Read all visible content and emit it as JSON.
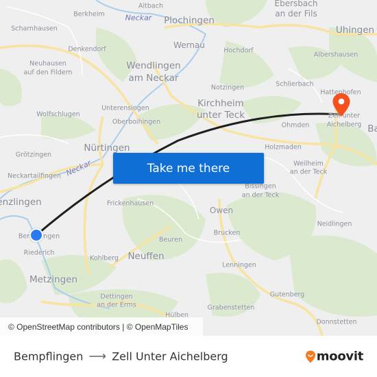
{
  "map": {
    "labels": {
      "altbach": "Altbach",
      "berkheim": "Berkheim",
      "neckar_top": "Neckar",
      "plochingen": "Plochingen",
      "ebersbach1": "Ebersbach",
      "ebersbach2": "an der Fils",
      "uhingen": "Uhingen",
      "scharnhausen": "Scharnhausen",
      "denkendorf": "Denkendorf",
      "wernau": "Wernau",
      "hochdorf": "Hochdorf",
      "albershausen": "Albershausen",
      "neuhausen1": "Neuhausen",
      "neuhausen2": "auf den Fildern",
      "wendlingen1": "Wendlingen",
      "wendlingen2": "am Neckar",
      "notzingen": "Notzingen",
      "schlierbach": "Schlierbach",
      "hattenhofen": "Hattenhofen",
      "unterensingen": "Unterensingen",
      "wolfschlugen": "Wolfschlugen",
      "kirchheim1": "Kirchheim",
      "kirchheim2": "unter Teck",
      "oberboihingen": "Oberboihingen",
      "ohmden": "Ohmden",
      "zell1": "Zell unter",
      "zell2": "Aichelberg",
      "ba": "Ba",
      "nurtingen": "Nürtingen",
      "holzmaden": "Holzmaden",
      "grotzingen": "Grötzingen",
      "weilheim1": "Weilheim",
      "weilheim2": "an der Teck",
      "neckartailfingen": "Neckartailfingen",
      "neckar_mid": "Neckar",
      "bissingen1": "Bissingen",
      "bissingen2": "an der Teck",
      "metzingen_top": "enzlingen",
      "frickenhausen": "Frickenhausen",
      "owen": "Owen",
      "neidlingen": "Neidlingen",
      "bempflingen": "Bempflingen",
      "brucken": "Brucken",
      "beuren": "Beuren",
      "riederich": "Riederich",
      "kohlberg": "Kohlberg",
      "neuffen": "Neuffen",
      "lenningen": "Lenningen",
      "metzingen": "Metzingen",
      "dettingen1": "Dettingen",
      "dettingen2": "an der Erms",
      "gutenberg": "Gutenberg",
      "grabenstetten": "Grabenstetten",
      "donnstetten": "Donnstetten",
      "hulben": "Hülben"
    },
    "cta_label": "Take me there",
    "attribution": "© OpenStreetMap contributors | © OpenMapTiles",
    "colors": {
      "route": "#1f1f1f",
      "origin": "#2a7bef",
      "destination": "#f4511e",
      "cta": "#0f6fd6",
      "road": "#fbe7a2",
      "forest": "#d9e8cc",
      "water": "#a9cdee"
    }
  },
  "footer": {
    "origin": "Bempflingen",
    "arrow": "⟶",
    "destination": "Zell Unter Aichelberg",
    "logo_text": "moovit",
    "logo_color": "#f47b20"
  }
}
